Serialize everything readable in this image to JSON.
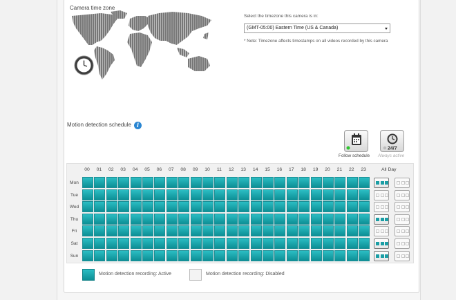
{
  "timezone_section": {
    "title": "Camera time zone",
    "select_label": "Select the timezone this camera is in:",
    "selected_timezone": "(GMT-05:00) Eastern Time (US & Canada)",
    "note": "* Note: Timezone affects timestamps on all videos recorded by this camera"
  },
  "schedule": {
    "title": "Motion detection schedule",
    "modes": {
      "follow": {
        "label": "Follow schedule",
        "icon": "calendar-icon",
        "status_color": "#2ec52e"
      },
      "always": {
        "label": "Always active",
        "icon": "clock-icon",
        "badge": "24/7"
      }
    },
    "hours": [
      "00",
      "01",
      "02",
      "03",
      "04",
      "05",
      "06",
      "07",
      "08",
      "09",
      "10",
      "11",
      "12",
      "13",
      "14",
      "15",
      "16",
      "17",
      "18",
      "19",
      "20",
      "21",
      "22",
      "23"
    ],
    "all_day_label": "All Day",
    "days": [
      {
        "label": "Mon",
        "all_day_active": true
      },
      {
        "label": "Tue",
        "all_day_active": false
      },
      {
        "label": "Wed",
        "all_day_active": false
      },
      {
        "label": "Thu",
        "all_day_active": true
      },
      {
        "label": "Fri",
        "all_day_active": false
      },
      {
        "label": "Sat",
        "all_day_active": true
      },
      {
        "label": "Sun",
        "all_day_active": true
      }
    ],
    "active_color": "#13a3aa"
  },
  "legend": {
    "active_label": "Motion detection recording: Active",
    "disabled_label": "Motion detection recording: Disabled"
  }
}
